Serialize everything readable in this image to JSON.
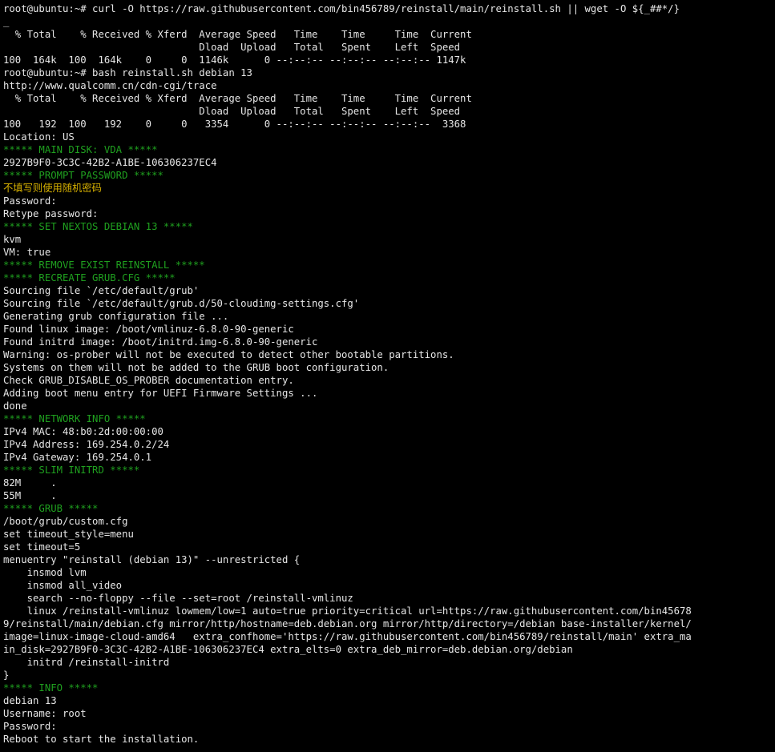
{
  "terminal": {
    "prompt": "root@ubuntu:~#",
    "lines": [
      {
        "t": "root@ubuntu:~# curl -O https://raw.githubusercontent.com/bin456789/reinstall/main/reinstall.sh || wget -O ${_##*/}",
        "k": "out"
      },
      {
        "t": "_",
        "k": "out"
      },
      {
        "t": "  % Total    % Received % Xferd  Average Speed   Time    Time     Time  Current",
        "k": "out"
      },
      {
        "t": "                                 Dload  Upload   Total   Spent    Left  Speed",
        "k": "out"
      },
      {
        "t": "100  164k  100  164k    0     0  1146k      0 --:--:-- --:--:-- --:--:-- 1147k",
        "k": "out"
      },
      {
        "t": "root@ubuntu:~# bash reinstall.sh debian 13",
        "k": "out"
      },
      {
        "t": "http://www.qualcomm.cn/cdn-cgi/trace",
        "k": "out"
      },
      {
        "t": "  % Total    % Received % Xferd  Average Speed   Time    Time     Time  Current",
        "k": "out"
      },
      {
        "t": "                                 Dload  Upload   Total   Spent    Left  Speed",
        "k": "out"
      },
      {
        "t": "100   192  100   192    0     0   3354      0 --:--:-- --:--:-- --:--:--  3368",
        "k": "out"
      },
      {
        "t": "Location: US",
        "k": "out"
      },
      {
        "t": "***** MAIN DISK: VDA *****",
        "k": "hdr"
      },
      {
        "t": "2927B9F0-3C3C-42B2-A1BE-106306237EC4",
        "k": "out"
      },
      {
        "t": "***** PROMPT PASSWORD *****",
        "k": "hdr"
      },
      {
        "t": "不填写则使用随机密码",
        "k": "cn"
      },
      {
        "t": "Password:",
        "k": "out"
      },
      {
        "t": "Retype password:",
        "k": "out"
      },
      {
        "t": "***** SET NEXTOS DEBIAN 13 *****",
        "k": "hdr"
      },
      {
        "t": "kvm",
        "k": "out"
      },
      {
        "t": "VM: true",
        "k": "out"
      },
      {
        "t": "***** REMOVE EXIST REINSTALL *****",
        "k": "hdr"
      },
      {
        "t": "***** RECREATE GRUB.CFG *****",
        "k": "hdr"
      },
      {
        "t": "Sourcing file `/etc/default/grub'",
        "k": "out"
      },
      {
        "t": "Sourcing file `/etc/default/grub.d/50-cloudimg-settings.cfg'",
        "k": "out"
      },
      {
        "t": "Generating grub configuration file ...",
        "k": "out"
      },
      {
        "t": "Found linux image: /boot/vmlinuz-6.8.0-90-generic",
        "k": "out"
      },
      {
        "t": "Found initrd image: /boot/initrd.img-6.8.0-90-generic",
        "k": "out"
      },
      {
        "t": "Warning: os-prober will not be executed to detect other bootable partitions.",
        "k": "out"
      },
      {
        "t": "Systems on them will not be added to the GRUB boot configuration.",
        "k": "out"
      },
      {
        "t": "Check GRUB_DISABLE_OS_PROBER documentation entry.",
        "k": "out"
      },
      {
        "t": "Adding boot menu entry for UEFI Firmware Settings ...",
        "k": "out"
      },
      {
        "t": "done",
        "k": "out"
      },
      {
        "t": "***** NETWORK INFO *****",
        "k": "hdr"
      },
      {
        "t": "IPv4 MAC: 48:b0:2d:00:00:00",
        "k": "out"
      },
      {
        "t": "IPv4 Address: 169.254.0.2/24",
        "k": "out"
      },
      {
        "t": "IPv4 Gateway: 169.254.0.1",
        "k": "out"
      },
      {
        "t": "***** SLIM INITRD *****",
        "k": "hdr"
      },
      {
        "t": "82M     .",
        "k": "out"
      },
      {
        "t": "55M     .",
        "k": "out"
      },
      {
        "t": "***** GRUB *****",
        "k": "hdr"
      },
      {
        "t": "/boot/grub/custom.cfg",
        "k": "out"
      },
      {
        "t": "set timeout_style=menu",
        "k": "out"
      },
      {
        "t": "set timeout=5",
        "k": "out"
      },
      {
        "t": "menuentry \"reinstall (debian 13)\" --unrestricted {",
        "k": "out"
      },
      {
        "t": "    insmod lvm",
        "k": "out"
      },
      {
        "t": "    insmod all_video",
        "k": "out"
      },
      {
        "t": "    search --no-floppy --file --set=root /reinstall-vmlinuz",
        "k": "out"
      },
      {
        "t": "    linux /reinstall-vmlinuz lowmem/low=1 auto=true priority=critical url=https://raw.githubusercontent.com/bin45678",
        "k": "out"
      },
      {
        "t": "9/reinstall/main/debian.cfg mirror/http/hostname=deb.debian.org mirror/http/directory=/debian base-installer/kernel/",
        "k": "out"
      },
      {
        "t": "image=linux-image-cloud-amd64   extra_confhome='https://raw.githubusercontent.com/bin456789/reinstall/main' extra_ma",
        "k": "out"
      },
      {
        "t": "in_disk=2927B9F0-3C3C-42B2-A1BE-106306237EC4 extra_elts=0 extra_deb_mirror=deb.debian.org/debian",
        "k": "out"
      },
      {
        "t": "    initrd /reinstall-initrd",
        "k": "out"
      },
      {
        "t": "}",
        "k": "out"
      },
      {
        "t": "***** INFO *****",
        "k": "hdr"
      },
      {
        "t": "debian 13",
        "k": "out"
      },
      {
        "t": "Username: root",
        "k": "out"
      },
      {
        "t": "Password:",
        "k": "out"
      },
      {
        "t": "Reboot to start the installation.",
        "k": "out"
      }
    ],
    "colors": {
      "background": "#000000",
      "text": "#e6e6e6",
      "section_header": "#1fa01f",
      "chinese_hint": "#d6b000"
    }
  }
}
